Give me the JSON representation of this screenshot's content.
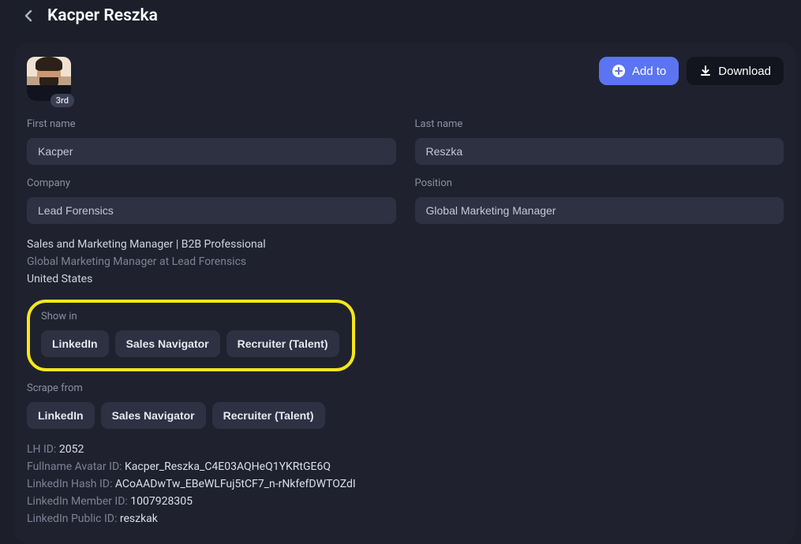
{
  "header": {
    "title": "Kacper Reszka"
  },
  "profile": {
    "degree_badge": "3rd"
  },
  "actions": {
    "add_to": "Add to",
    "download": "Download"
  },
  "form": {
    "first_name_label": "First name",
    "first_name_value": "Kacper",
    "last_name_label": "Last name",
    "last_name_value": "Reszka",
    "company_label": "Company",
    "company_value": "Lead Forensics",
    "position_label": "Position",
    "position_value": "Global Marketing Manager"
  },
  "meta": {
    "headline": "Sales and Marketing Manager | B2B Professional",
    "subheadline": "Global Marketing Manager at Lead Forensics",
    "location": "United States"
  },
  "show_in": {
    "label": "Show in",
    "options": [
      "LinkedIn",
      "Sales Navigator",
      "Recruiter (Talent)"
    ]
  },
  "scrape_from": {
    "label": "Scrape from",
    "options": [
      "LinkedIn",
      "Sales Navigator",
      "Recruiter (Talent)"
    ]
  },
  "ids": {
    "lh_id_label": "LH ID: ",
    "lh_id_value": "2052",
    "fullname_avatar_id_label": "Fullname Avatar ID: ",
    "fullname_avatar_id_value": "Kacper_Reszka_C4E03AQHeQ1YKRtGE6Q",
    "linkedin_hash_id_label": "LinkedIn Hash ID: ",
    "linkedin_hash_id_value": "ACoAADwTw_EBeWLFuj5tCF7_n-rNkfefDWTOZdI",
    "linkedin_member_id_label": "LinkedIn Member ID: ",
    "linkedin_member_id_value": "1007928305",
    "linkedin_public_id_label": "LinkedIn Public ID: ",
    "linkedin_public_id_value": "reszkak"
  }
}
